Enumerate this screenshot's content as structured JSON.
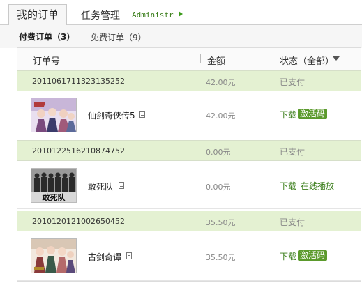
{
  "tabs": {
    "my_orders": "我的订单",
    "task_manage": "任务管理",
    "admin": "Administr"
  },
  "filters": {
    "paid": "付费订单（3）",
    "free": "免费订单（9）"
  },
  "columns": {
    "order_no": "订单号",
    "amount": "金额",
    "status": "状态（全部）"
  },
  "orders": [
    {
      "id": "2011061711323135252",
      "amount": "42.00元",
      "status": "已支付",
      "product": "仙剑奇侠传5",
      "product_amount": "42.00元",
      "download": "下载",
      "action": "激活码",
      "action_style": "badge"
    },
    {
      "id": "2010122516210874752",
      "amount": "0.00元",
      "status": "已支付",
      "product": "敢死队",
      "product_amount": "0.00元",
      "download": "下载",
      "action": "在线播放",
      "action_style": "link"
    },
    {
      "id": "2010120121002650452",
      "amount": "35.50元",
      "status": "已支付",
      "product": "古剑奇谭",
      "product_amount": "35.50元",
      "download": "下载",
      "action": "激活码",
      "action_style": "badge"
    }
  ],
  "thumb_captions": {
    "movie": "敢死队"
  },
  "colors": {
    "accent": "#3a7d1a",
    "badge": "#5b9a2c",
    "order_header_bg": "#e4f1d2"
  }
}
